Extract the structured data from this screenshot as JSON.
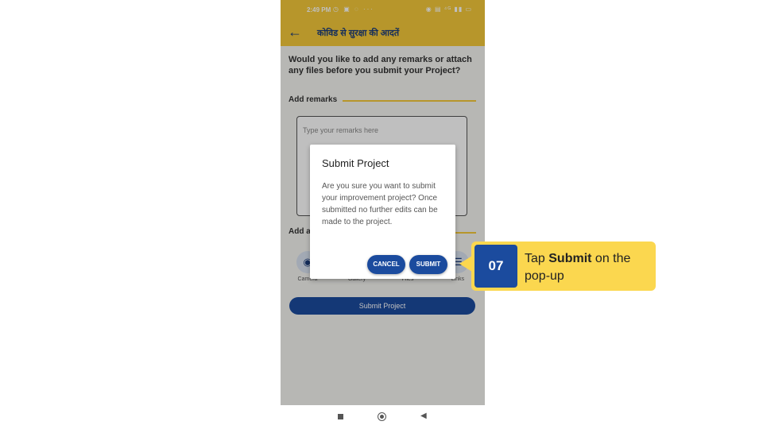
{
  "status_bar": {
    "time": "2:49 PM",
    "left_icons": "◷ ▣ ◌ ···",
    "right_icons": "◉ ▤ ⁴ᴳ ▮▮ ▭"
  },
  "app_bar": {
    "back_icon": "arrow-left-icon",
    "title": "कोविड से सुरक्षा की आदतें"
  },
  "screen": {
    "question": "Would you like to add any remarks or attach any files before you submit your Project?",
    "add_remarks_label": "Add remarks",
    "remarks_placeholder": "Type your remarks here",
    "add_attachments_label": "Add a",
    "attachments": [
      {
        "label": "Camera",
        "icon": "camera-icon"
      },
      {
        "label": "Gallery",
        "icon": "gallery-icon"
      },
      {
        "label": "Files",
        "icon": "files-icon"
      },
      {
        "label": "Links",
        "icon": "links-icon"
      }
    ],
    "submit_project_label": "Submit Project"
  },
  "dialog": {
    "title": "Submit Project",
    "message": "Are you sure you want to submit your improvement project? Once submitted no further edits can be made to the project.",
    "cancel_label": "CANCEL",
    "submit_label": "SUBMIT"
  },
  "callout": {
    "step": "07",
    "prefix": "Tap ",
    "bold": "Submit",
    "suffix": " on the pop-up"
  },
  "colors": {
    "accent_yellow": "#f4c93a",
    "primary_blue": "#1b4b9e",
    "callout_yellow": "#fbd74f"
  }
}
